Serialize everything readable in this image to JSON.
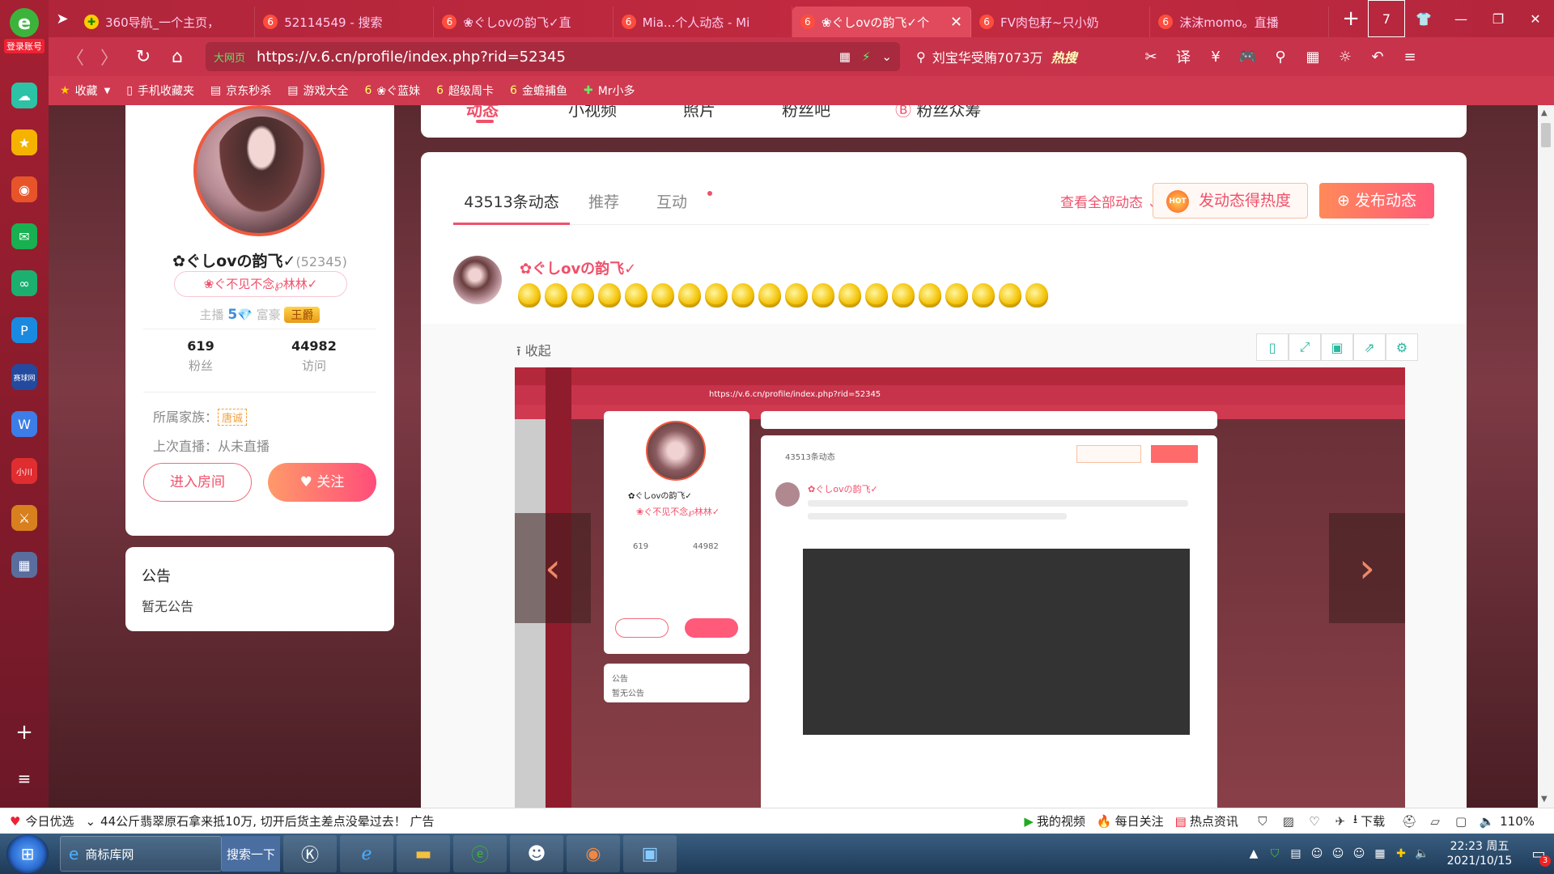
{
  "rail": {
    "login_label": "登录账号",
    "apps": [
      "cloud-icon",
      "star-icon",
      "weibo-icon",
      "mail-icon",
      "link-icon",
      "p-icon",
      "game-icon",
      "doc-icon",
      "mini-icon",
      "warrior-icon",
      "city-icon"
    ],
    "mini_label": "小川",
    "game_label": "赛球网"
  },
  "tabs": [
    {
      "label": "360导航_一个主页，",
      "icon": "360-icon",
      "color": "#ffcc00"
    },
    {
      "label": "52114549 - 搜索",
      "icon": "v6-icon",
      "color": "#ff4d3d"
    },
    {
      "label": "❀ぐしovの韵飞✓直",
      "icon": "v6-icon",
      "color": "#ff4d3d"
    },
    {
      "label": "Mia...个人动态 - Mi",
      "icon": "v6-icon",
      "color": "#ff4d3d"
    },
    {
      "label": "❀ぐしovの韵飞✓个",
      "icon": "v6-icon",
      "color": "#ff4d3d",
      "active": true
    },
    {
      "label": "FV肉包耔~只小奶",
      "icon": "v6-icon",
      "color": "#ff4d3d"
    },
    {
      "label": "沫沫momo。直播",
      "icon": "v6-icon",
      "color": "#ff4d3d"
    }
  ],
  "titlebar": {
    "tab_count": "7"
  },
  "address": {
    "url": "https://v.6.cn/profile/index.php?rid=52345",
    "secure_label": "大网页",
    "search_placeholder": "刘宝华受贿7073万",
    "hot_label": "热搜"
  },
  "bookmarks": [
    "收藏",
    "手机收藏夹",
    "京东秒杀",
    "游戏大全",
    "❀ぐ蓝妹",
    "超级周卡",
    "金蟾捕鱼",
    "Mr小多"
  ],
  "profile": {
    "name": "✿ぐしovの韵飞✓",
    "rid": "(52345)",
    "motto": "❀ぐ不见不念℘林林✓",
    "anchor_label": "主播",
    "anchor_level": "5",
    "rich_label": "富豪",
    "rich_badge": "王爵",
    "fans_num": "619",
    "fans_label": "粉丝",
    "visits_num": "44982",
    "visits_label": "访问",
    "family_label": "所属家族：",
    "family_value": "唐诚",
    "last_live": "上次直播：从未直播",
    "enter_btn": "进入房间",
    "follow_btn": "关注"
  },
  "notice": {
    "title": "公告",
    "content": "暂无公告"
  },
  "topnav": {
    "items": [
      "动态",
      "小视频",
      "照片",
      "粉丝吧",
      "粉丝众筹"
    ]
  },
  "feed": {
    "tabs": [
      "43513条动态",
      "推荐",
      "互动"
    ],
    "view_all": "查看全部动态",
    "hot_btn": "发动态得热度",
    "hot_icon_text": "HOT",
    "post_btn": "发布动态",
    "post_author": "✿ぐしovの韵飞✓",
    "emoji_count": 20,
    "collapse": "收起"
  },
  "status": {
    "left": [
      "今日优选",
      "44公斤翡翠原石拿来抵10万, 切开后货主差点没晕过去！ 广告"
    ],
    "right": [
      "我的视频",
      "每日关注",
      "热点资讯",
      "下载"
    ],
    "zoom": "110%"
  },
  "taskbar": {
    "task_label": "商标库网",
    "search_label": "搜索一下",
    "time": "22:23 周五",
    "date": "2021/10/15",
    "notify_count": "3"
  }
}
